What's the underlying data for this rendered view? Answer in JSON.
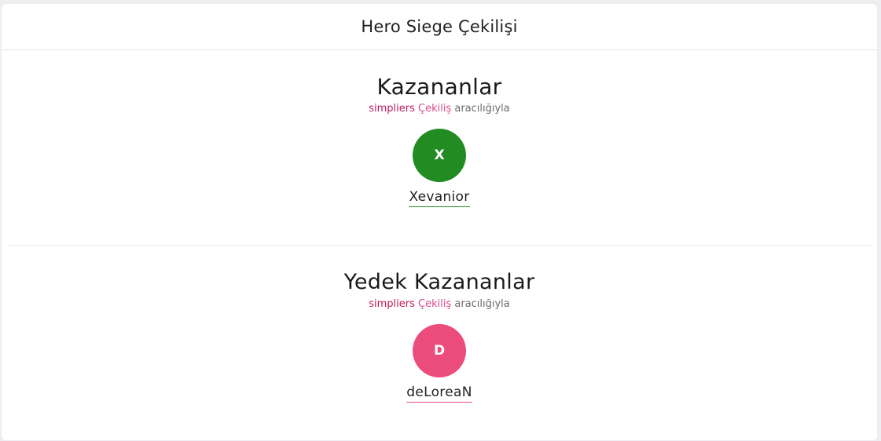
{
  "header": {
    "title": "Hero Siege Çekilişi"
  },
  "winners": {
    "title": "Kazananlar",
    "byline": {
      "brand": "simpliers",
      "product": "Çekiliş",
      "suffix": "aracılığıyla"
    },
    "items": [
      {
        "initial": "X",
        "name": "Xevanior",
        "color": "#228b22"
      }
    ]
  },
  "backups": {
    "title": "Yedek Kazananlar",
    "byline": {
      "brand": "simpliers",
      "product": "Çekiliş",
      "suffix": "aracılığıyla"
    },
    "items": [
      {
        "initial": "D",
        "name": "deLoreaN",
        "color": "#ec4c7c"
      }
    ]
  },
  "colors": {
    "brand": "#c2185b",
    "product": "#d94a8c"
  }
}
